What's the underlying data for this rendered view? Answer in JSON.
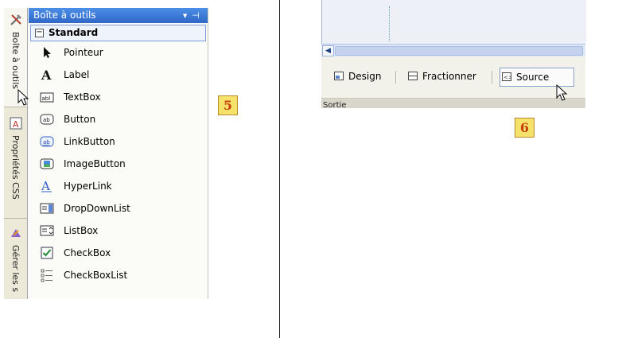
{
  "toolbox_panel": {
    "side_tabs": [
      {
        "label": "Boîte à outils",
        "icon": "tools-icon"
      },
      {
        "label": "Propriétés CSS",
        "icon": "css-properties-icon"
      },
      {
        "label": "Gérer les s",
        "icon": "manage-styles-icon"
      }
    ],
    "header": {
      "title": "Boîte à outils",
      "buttons": [
        "dropdown-arrow-icon",
        "pin-icon"
      ]
    },
    "group": {
      "label": "Standard",
      "collapse_symbol": "⊟"
    },
    "tools": [
      {
        "label": "Pointeur",
        "icon": "pointer-icon"
      },
      {
        "label": "Label",
        "icon": "label-icon"
      },
      {
        "label": "TextBox",
        "icon": "textbox-icon"
      },
      {
        "label": "Button",
        "icon": "button-icon"
      },
      {
        "label": "LinkButton",
        "icon": "linkbutton-icon"
      },
      {
        "label": "ImageButton",
        "icon": "imagebutton-icon"
      },
      {
        "label": "HyperLink",
        "icon": "hyperlink-icon"
      },
      {
        "label": "DropDownList",
        "icon": "dropdownlist-icon"
      },
      {
        "label": "ListBox",
        "icon": "listbox-icon"
      },
      {
        "label": "CheckBox",
        "icon": "checkbox-icon"
      },
      {
        "label": "CheckBoxList",
        "icon": "checkboxlist-icon"
      }
    ]
  },
  "markers": {
    "five": "5",
    "six": "6"
  },
  "editor_panel": {
    "view_buttons": {
      "design": "Design",
      "split": "Fractionner",
      "source": "Source"
    },
    "bottom_strip_text": "Sortie"
  },
  "colors": {
    "header_blue": "#3a7ad9",
    "marker_bg": "#f6e26b",
    "marker_text": "#c2410c"
  }
}
